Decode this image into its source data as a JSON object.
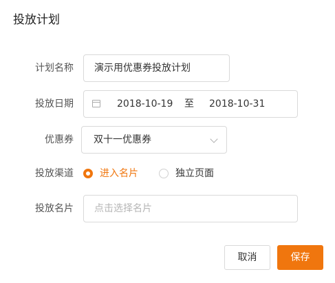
{
  "dialog": {
    "title": "投放计划"
  },
  "form": {
    "plan_name": {
      "label": "计划名称",
      "value": "演示用优惠券投放计划"
    },
    "date_range": {
      "label": "投放日期",
      "start": "2018-10-19",
      "separator": "至",
      "end": "2018-10-31",
      "icon": "calendar-icon"
    },
    "coupon": {
      "label": "优惠券",
      "selected": "双十一优惠券",
      "icon": "chevron-down-icon"
    },
    "channel": {
      "label": "投放渠道",
      "options": [
        {
          "label": "进入名片",
          "checked": true
        },
        {
          "label": "独立页面",
          "checked": false
        }
      ]
    },
    "card": {
      "label": "投放名片",
      "placeholder": "点击选择名片"
    }
  },
  "actions": {
    "cancel_label": "取消",
    "save_label": "保存"
  },
  "colors": {
    "accent": "#f0760e",
    "border": "#d9d9d9",
    "placeholder": "#b5b5b5"
  }
}
